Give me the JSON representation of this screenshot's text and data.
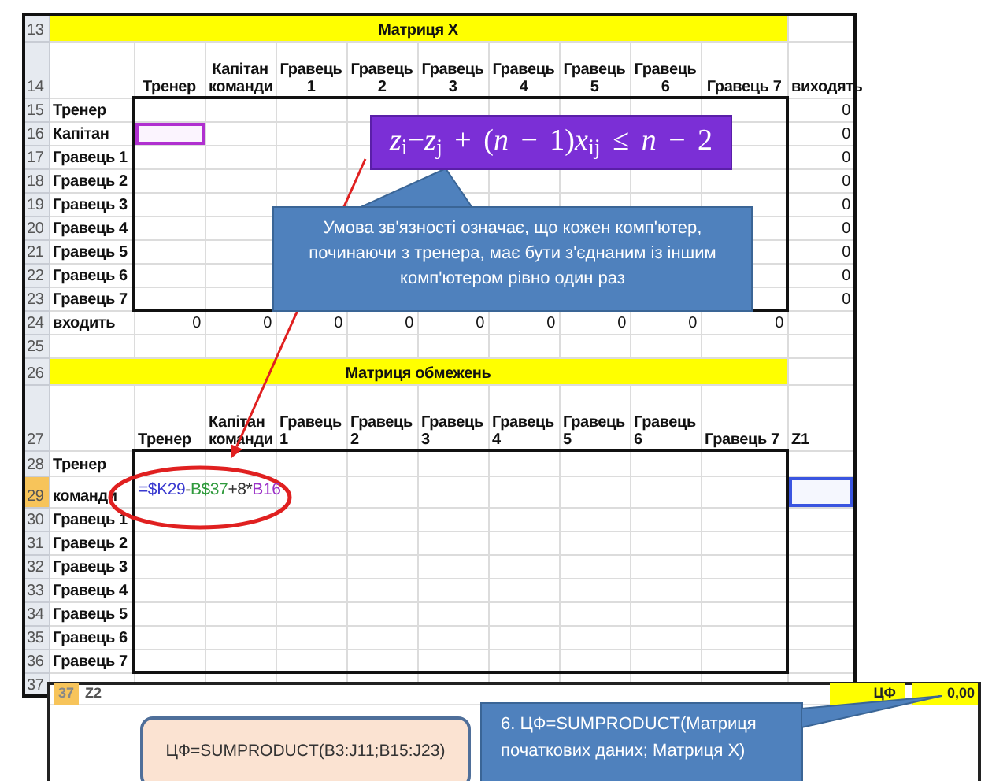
{
  "matrix_x": {
    "row_number": "13",
    "title": "Матриця X",
    "header_row_number": "14",
    "columns": [
      "Тренер",
      "Капітан команди",
      "Гравець 1",
      "Гравець 2",
      "Гравець 3",
      "Гравець 4",
      "Гравець 5",
      "Гравець 6",
      "Гравець 7",
      "виходять"
    ],
    "rows": [
      {
        "number": "15",
        "label": "Тренер",
        "out": "0",
        "selected": false
      },
      {
        "number": "16",
        "label": "Капітан",
        "out": "0",
        "selected": true
      },
      {
        "number": "17",
        "label": "Гравець 1",
        "out": "0",
        "selected": false
      },
      {
        "number": "18",
        "label": "Гравець 2",
        "out": "0",
        "selected": false
      },
      {
        "number": "19",
        "label": "Гравець 3",
        "out": "0",
        "selected": false
      },
      {
        "number": "20",
        "label": "Гравець 4",
        "out": "0",
        "selected": false
      },
      {
        "number": "21",
        "label": "Гравець 5",
        "out": "0",
        "selected": false
      },
      {
        "number": "22",
        "label": "Гравець 6",
        "out": "0",
        "selected": false
      },
      {
        "number": "23",
        "label": "Гравець 7",
        "out": "0",
        "selected": false
      }
    ],
    "totals": {
      "number": "24",
      "label": "входить",
      "values": [
        "0",
        "0",
        "0",
        "0",
        "0",
        "0",
        "0",
        "0",
        "0"
      ]
    }
  },
  "spacer_row": {
    "number": "25"
  },
  "constraints": {
    "row_number": "26",
    "title": "Матриця обмежень",
    "header_row_number": "27",
    "columns": [
      "Тренер",
      "Капітан команди",
      "Гравець 1",
      "Гравець 2",
      "Гравець 3",
      "Гравець 4",
      "Гравець 5",
      "Гравець 6",
      "Гравець 7",
      "Z1"
    ],
    "rows": [
      {
        "number": "28",
        "label": "Тренер",
        "selected": false
      },
      {
        "number": "29",
        "label": "команди",
        "selected": true,
        "formula": [
          {
            "text": "=$K29",
            "color": "#3a3ad0"
          },
          {
            "text": "-",
            "color": "#333333"
          },
          {
            "text": "B$37",
            "color": "#2f9a3c"
          },
          {
            "text": "+8*",
            "color": "#333333"
          },
          {
            "text": "B16",
            "color": "#9b30c8"
          }
        ]
      },
      {
        "number": "30",
        "label": "Гравець 1",
        "selected": false
      },
      {
        "number": "31",
        "label": "Гравець 2",
        "selected": false
      },
      {
        "number": "32",
        "label": "Гравець 3",
        "selected": false
      },
      {
        "number": "33",
        "label": "Гравець 4",
        "selected": false
      },
      {
        "number": "34",
        "label": "Гравець 5",
        "selected": false
      },
      {
        "number": "35",
        "label": "Гравець 6",
        "selected": false
      },
      {
        "number": "36",
        "label": "Гравець 7",
        "selected": false
      }
    ]
  },
  "result_row": {
    "number": "37",
    "cells": [
      "37",
      "Z2"
    ],
    "objective_label": "ЦФ",
    "objective_value": "0,00"
  },
  "formula_note": "*z*$_{i}$−*z*$_{j}$ + (*n* − 1)*x*$_{ij}$ ≤ *n* − 2",
  "connectivity_note": "Умова зв'язності означає, що кожен комп'ютер, починаючи з тренера, має бути з'єднаним із іншим комп'ютером рівно один раз",
  "note": "ЦФ=SUMPRODUCT(B3:J11;B15:J23)",
  "callout": "6. ЦФ=SUMPRODUCT(Матриця початкових даних; Матриця Х)"
}
